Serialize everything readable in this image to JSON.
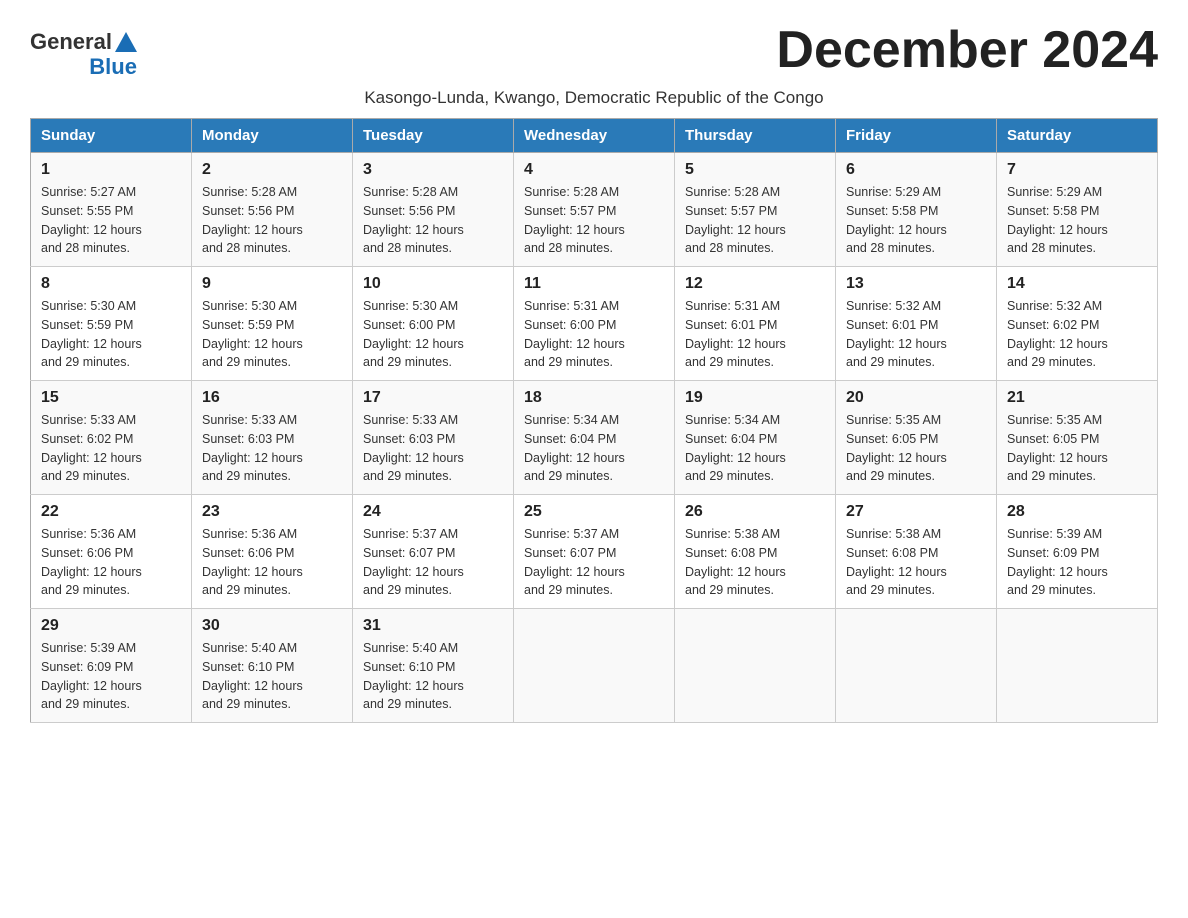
{
  "logo": {
    "general": "General",
    "blue": "Blue"
  },
  "title": "December 2024",
  "subtitle": "Kasongo-Lunda, Kwango, Democratic Republic of the Congo",
  "headers": [
    "Sunday",
    "Monday",
    "Tuesday",
    "Wednesday",
    "Thursday",
    "Friday",
    "Saturday"
  ],
  "weeks": [
    [
      {
        "day": "1",
        "sunrise": "5:27 AM",
        "sunset": "5:55 PM",
        "daylight": "12 hours and 28 minutes."
      },
      {
        "day": "2",
        "sunrise": "5:28 AM",
        "sunset": "5:56 PM",
        "daylight": "12 hours and 28 minutes."
      },
      {
        "day": "3",
        "sunrise": "5:28 AM",
        "sunset": "5:56 PM",
        "daylight": "12 hours and 28 minutes."
      },
      {
        "day": "4",
        "sunrise": "5:28 AM",
        "sunset": "5:57 PM",
        "daylight": "12 hours and 28 minutes."
      },
      {
        "day": "5",
        "sunrise": "5:28 AM",
        "sunset": "5:57 PM",
        "daylight": "12 hours and 28 minutes."
      },
      {
        "day": "6",
        "sunrise": "5:29 AM",
        "sunset": "5:58 PM",
        "daylight": "12 hours and 28 minutes."
      },
      {
        "day": "7",
        "sunrise": "5:29 AM",
        "sunset": "5:58 PM",
        "daylight": "12 hours and 28 minutes."
      }
    ],
    [
      {
        "day": "8",
        "sunrise": "5:30 AM",
        "sunset": "5:59 PM",
        "daylight": "12 hours and 29 minutes."
      },
      {
        "day": "9",
        "sunrise": "5:30 AM",
        "sunset": "5:59 PM",
        "daylight": "12 hours and 29 minutes."
      },
      {
        "day": "10",
        "sunrise": "5:30 AM",
        "sunset": "6:00 PM",
        "daylight": "12 hours and 29 minutes."
      },
      {
        "day": "11",
        "sunrise": "5:31 AM",
        "sunset": "6:00 PM",
        "daylight": "12 hours and 29 minutes."
      },
      {
        "day": "12",
        "sunrise": "5:31 AM",
        "sunset": "6:01 PM",
        "daylight": "12 hours and 29 minutes."
      },
      {
        "day": "13",
        "sunrise": "5:32 AM",
        "sunset": "6:01 PM",
        "daylight": "12 hours and 29 minutes."
      },
      {
        "day": "14",
        "sunrise": "5:32 AM",
        "sunset": "6:02 PM",
        "daylight": "12 hours and 29 minutes."
      }
    ],
    [
      {
        "day": "15",
        "sunrise": "5:33 AM",
        "sunset": "6:02 PM",
        "daylight": "12 hours and 29 minutes."
      },
      {
        "day": "16",
        "sunrise": "5:33 AM",
        "sunset": "6:03 PM",
        "daylight": "12 hours and 29 minutes."
      },
      {
        "day": "17",
        "sunrise": "5:33 AM",
        "sunset": "6:03 PM",
        "daylight": "12 hours and 29 minutes."
      },
      {
        "day": "18",
        "sunrise": "5:34 AM",
        "sunset": "6:04 PM",
        "daylight": "12 hours and 29 minutes."
      },
      {
        "day": "19",
        "sunrise": "5:34 AM",
        "sunset": "6:04 PM",
        "daylight": "12 hours and 29 minutes."
      },
      {
        "day": "20",
        "sunrise": "5:35 AM",
        "sunset": "6:05 PM",
        "daylight": "12 hours and 29 minutes."
      },
      {
        "day": "21",
        "sunrise": "5:35 AM",
        "sunset": "6:05 PM",
        "daylight": "12 hours and 29 minutes."
      }
    ],
    [
      {
        "day": "22",
        "sunrise": "5:36 AM",
        "sunset": "6:06 PM",
        "daylight": "12 hours and 29 minutes."
      },
      {
        "day": "23",
        "sunrise": "5:36 AM",
        "sunset": "6:06 PM",
        "daylight": "12 hours and 29 minutes."
      },
      {
        "day": "24",
        "sunrise": "5:37 AM",
        "sunset": "6:07 PM",
        "daylight": "12 hours and 29 minutes."
      },
      {
        "day": "25",
        "sunrise": "5:37 AM",
        "sunset": "6:07 PM",
        "daylight": "12 hours and 29 minutes."
      },
      {
        "day": "26",
        "sunrise": "5:38 AM",
        "sunset": "6:08 PM",
        "daylight": "12 hours and 29 minutes."
      },
      {
        "day": "27",
        "sunrise": "5:38 AM",
        "sunset": "6:08 PM",
        "daylight": "12 hours and 29 minutes."
      },
      {
        "day": "28",
        "sunrise": "5:39 AM",
        "sunset": "6:09 PM",
        "daylight": "12 hours and 29 minutes."
      }
    ],
    [
      {
        "day": "29",
        "sunrise": "5:39 AM",
        "sunset": "6:09 PM",
        "daylight": "12 hours and 29 minutes."
      },
      {
        "day": "30",
        "sunrise": "5:40 AM",
        "sunset": "6:10 PM",
        "daylight": "12 hours and 29 minutes."
      },
      {
        "day": "31",
        "sunrise": "5:40 AM",
        "sunset": "6:10 PM",
        "daylight": "12 hours and 29 minutes."
      },
      null,
      null,
      null,
      null
    ]
  ],
  "labels": {
    "sunrise": "Sunrise:",
    "sunset": "Sunset:",
    "daylight": "Daylight:"
  }
}
